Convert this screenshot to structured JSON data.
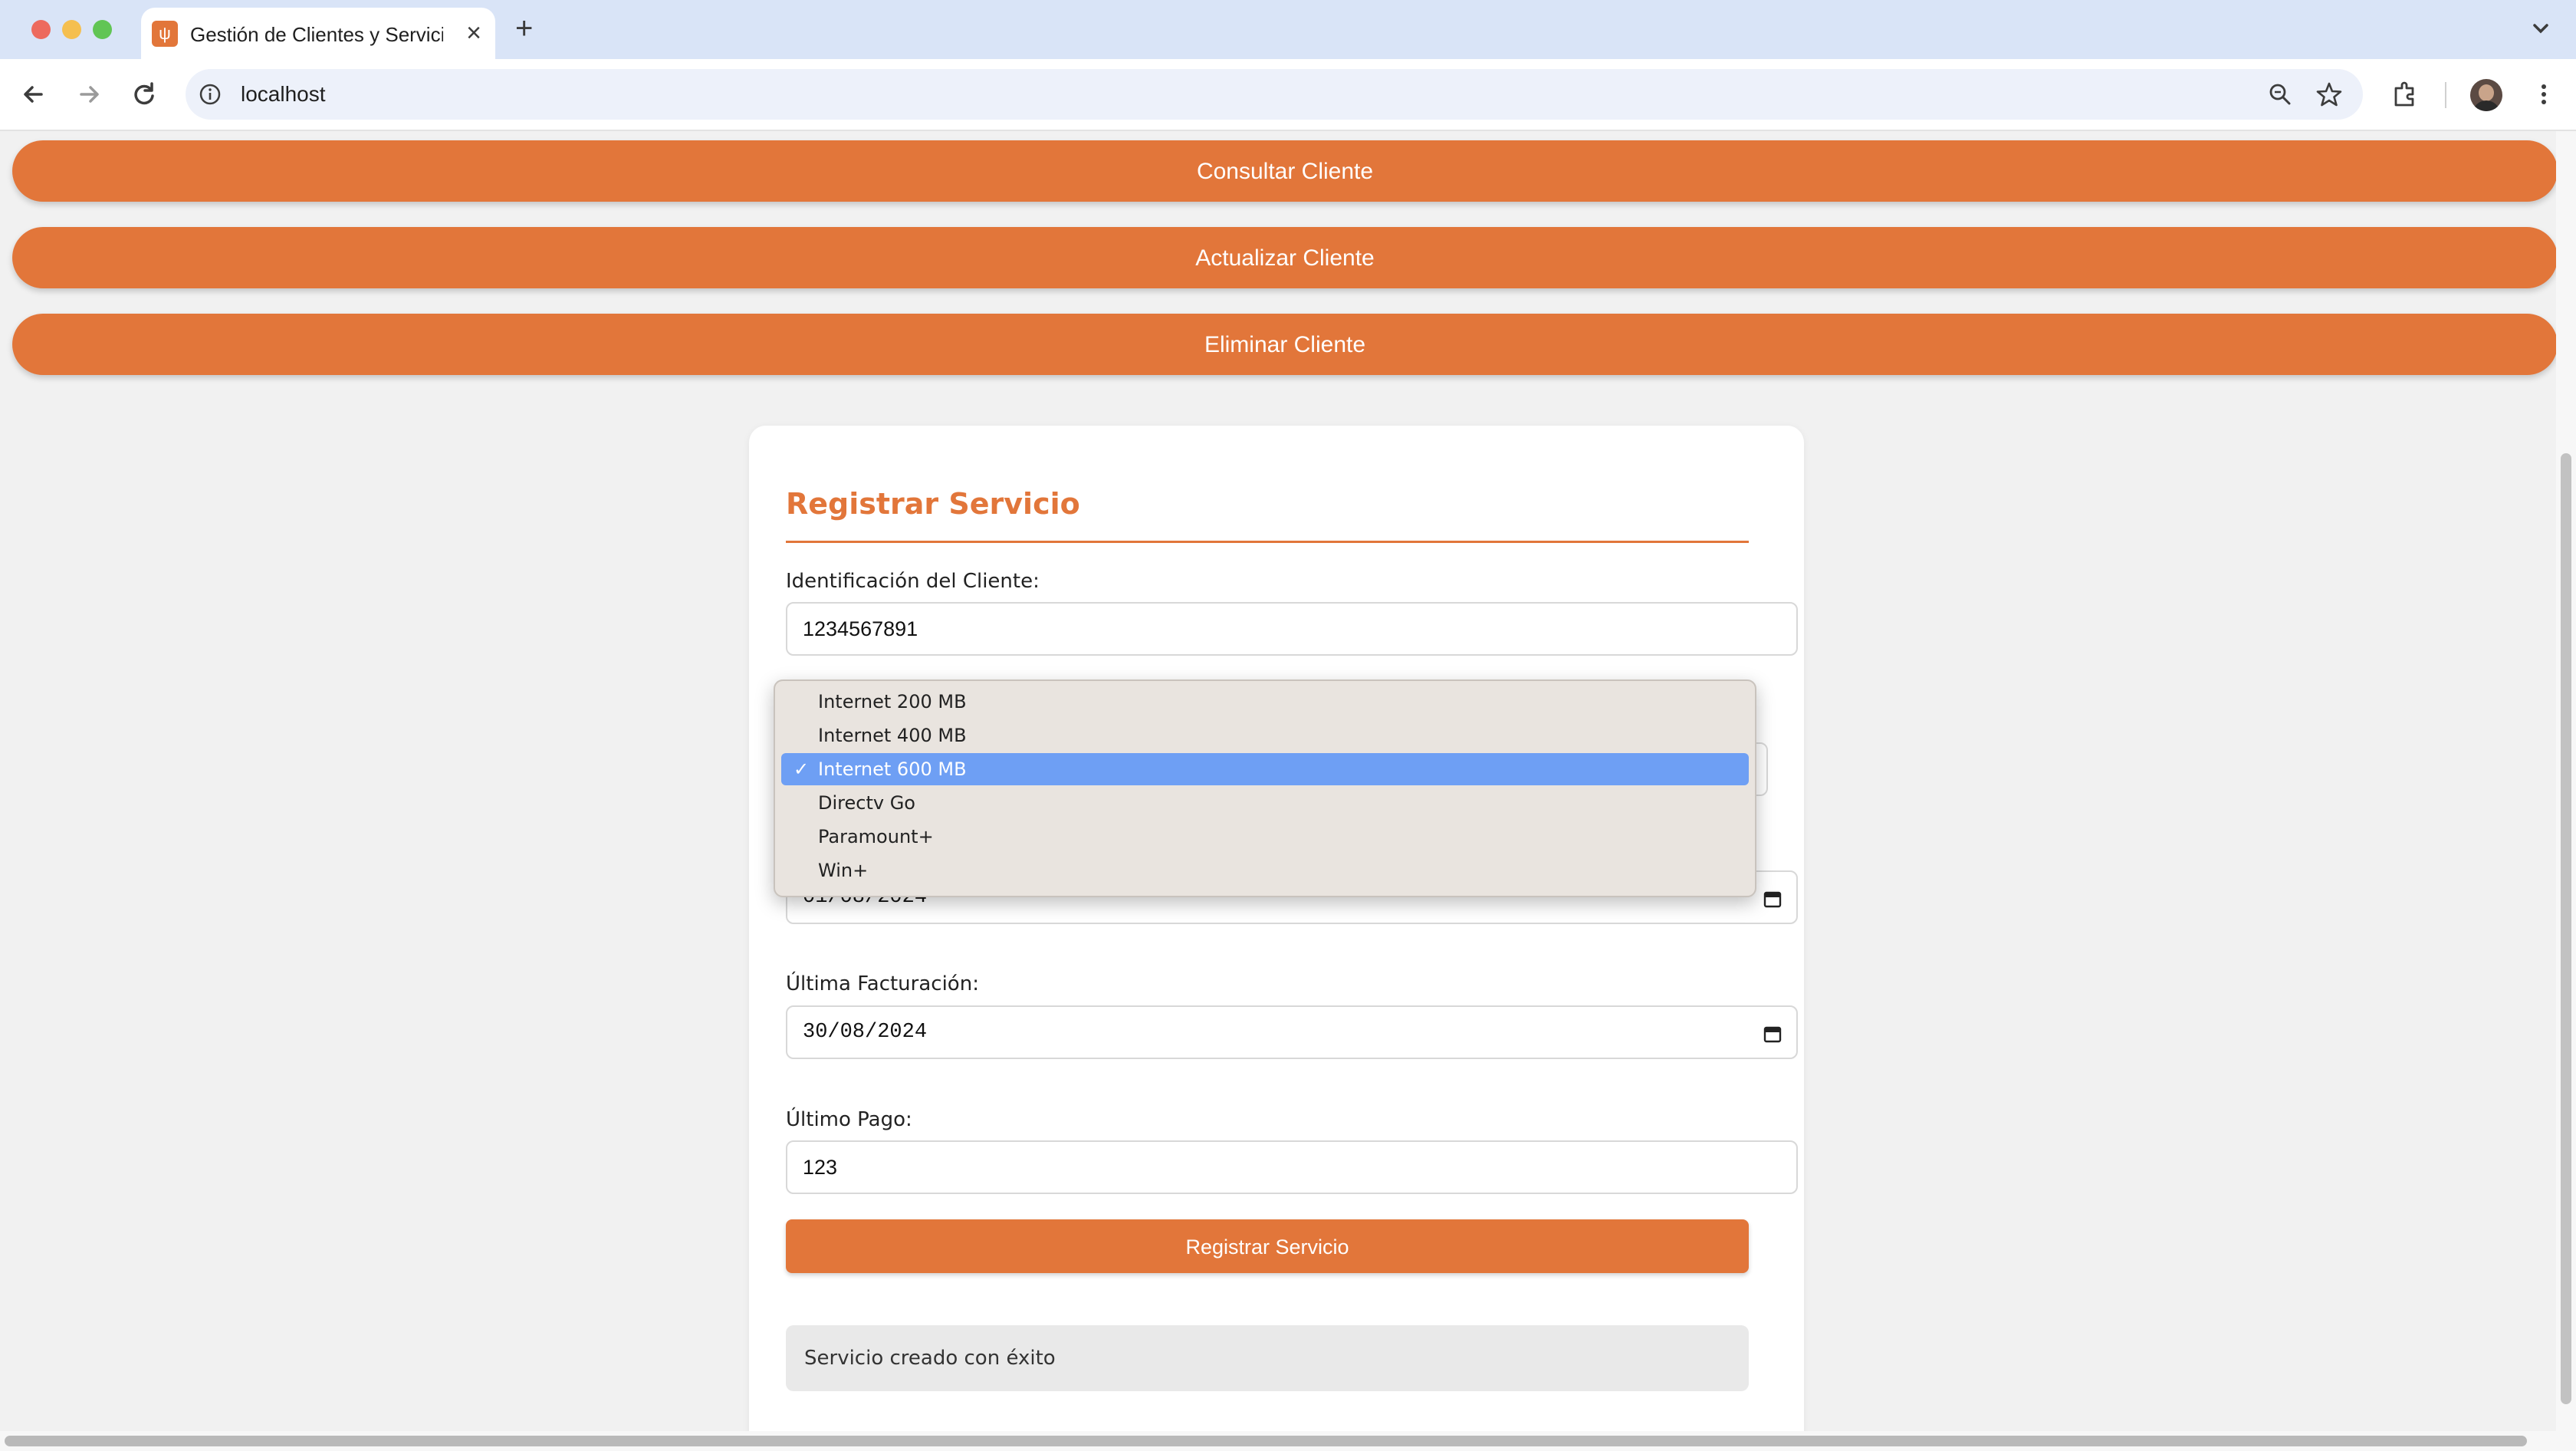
{
  "browser": {
    "tab_title": "Gestión de Clientes y Servicio",
    "tab_close_glyph": "×",
    "new_tab_glyph": "+",
    "favicon_glyph": "ψ",
    "url": "localhost",
    "icons": [
      "back-arrow-icon",
      "forward-arrow-icon",
      "reload-icon",
      "info-icon",
      "zoom-icon",
      "star-icon",
      "extensions-icon",
      "avatar",
      "kebab-menu-icon",
      "chevron-down-icon"
    ]
  },
  "actions": {
    "consultar": "Consultar Cliente",
    "actualizar": "Actualizar Cliente",
    "eliminar": "Eliminar Cliente"
  },
  "form": {
    "title": "Registrar Servicio",
    "id_label": "Identificación del Cliente:",
    "id_value": "1234567891",
    "service_options": [
      "Internet 200 MB",
      "Internet 400 MB",
      "Internet 600 MB",
      "Directv Go",
      "Paramount+",
      "Win+"
    ],
    "service_selected": "Internet 600 MB",
    "start_date_value": "01/08/2024",
    "last_billing_label": "Última Facturación:",
    "last_billing_value": "30/08/2024",
    "last_payment_label": "Último Pago:",
    "last_payment_value": "123",
    "submit_label": "Registrar Servicio",
    "message": "Servicio creado con éxito"
  },
  "colors": {
    "accent": "#e2763a",
    "selected_option": "#6e9ff4",
    "dropdown_bg": "#e9e4df"
  }
}
